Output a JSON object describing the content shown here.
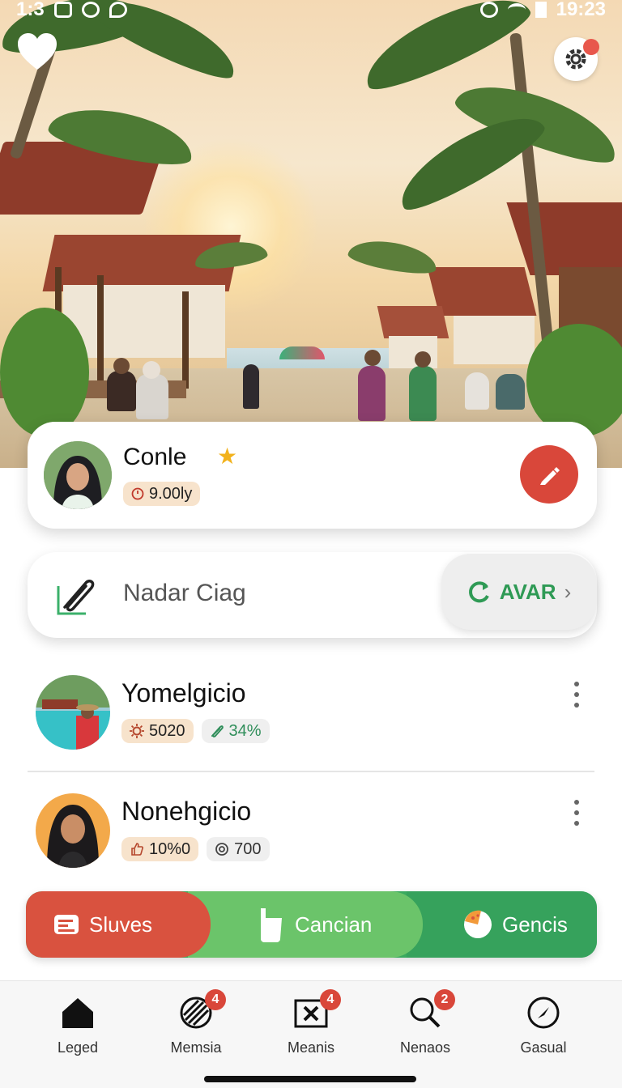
{
  "status_bar": {
    "time_left": "1:3",
    "time_right": "19:23"
  },
  "profile": {
    "name": "Conle",
    "chip_value": "9.00ly"
  },
  "action": {
    "label": "Nadar Ciag",
    "button_label": "AVAR"
  },
  "list": [
    {
      "title": "Yomelgicio",
      "chip1": "5020",
      "chip2": "34%"
    },
    {
      "title": "Nonehgicio",
      "chip1": "10%0",
      "chip2": "700"
    }
  ],
  "segments": [
    {
      "label": "Sluves",
      "color": "#d9523f"
    },
    {
      "label": "Cancian",
      "color": "#6bc46a"
    },
    {
      "label": "Gencis",
      "color": "#36a25c"
    }
  ],
  "bottom_nav": [
    {
      "label": "Leged",
      "icon": "home-icon",
      "badge": ""
    },
    {
      "label": "Memsia",
      "icon": "striped-ball-icon",
      "badge": "4"
    },
    {
      "label": "Meanis",
      "icon": "close-box-icon",
      "badge": "4"
    },
    {
      "label": "Nenaos",
      "icon": "search-icon",
      "badge": "2"
    },
    {
      "label": "Gasual",
      "icon": "compass-icon",
      "badge": ""
    }
  ],
  "colors": {
    "accent_red": "#d9473a",
    "accent_green": "#2f9a55",
    "star": "#f2b21c"
  }
}
